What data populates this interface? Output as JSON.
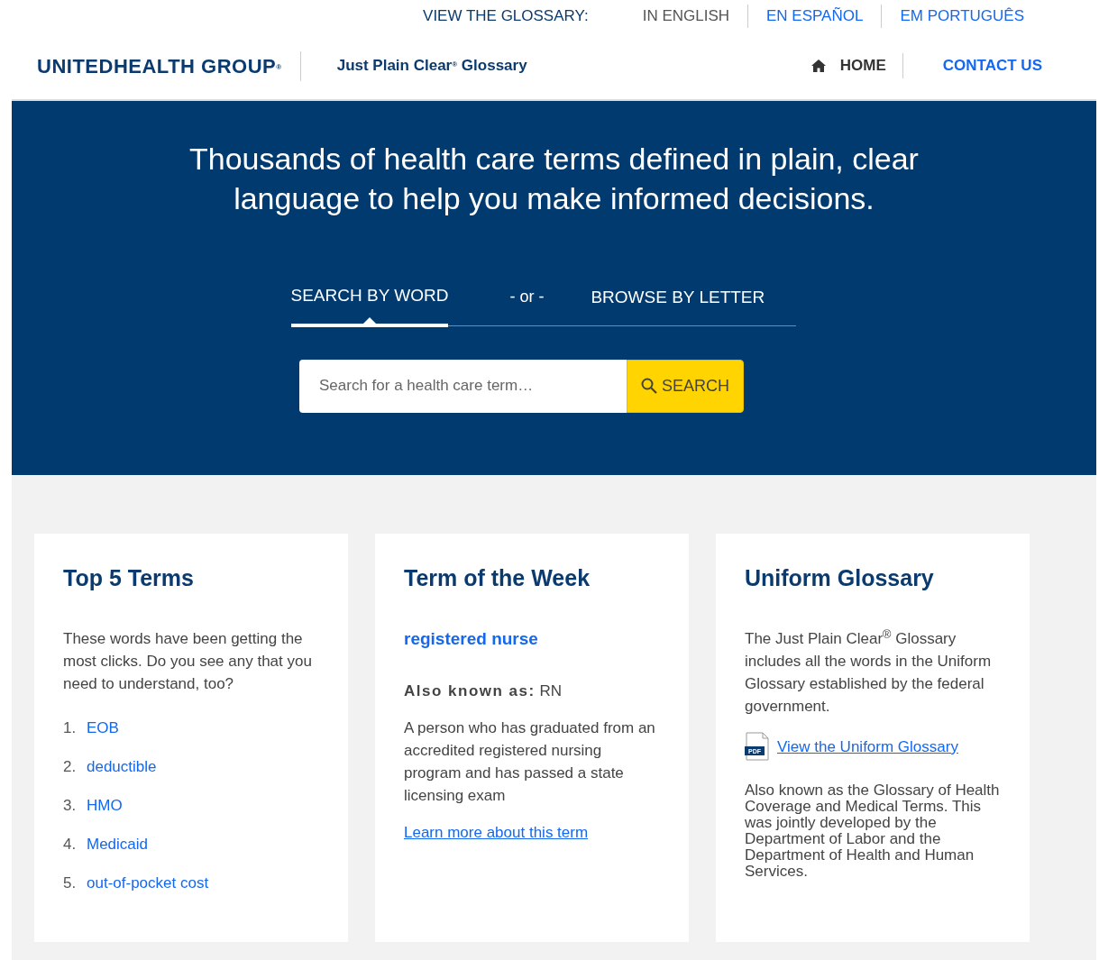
{
  "language_bar": {
    "label": "VIEW THE GLOSSARY:",
    "languages": [
      {
        "label": "IN ENGLISH",
        "selected": true
      },
      {
        "label": "EN ESPAÑOL",
        "selected": false
      },
      {
        "label": "EM PORTUGUÊS",
        "selected": false
      }
    ]
  },
  "header": {
    "logo": "UNITEDHEALTH GROUP$^{®}$",
    "site_title": "Just Plain Clear$^{®}$ Glossary",
    "nav": [
      {
        "label": "HOME",
        "kind": "home"
      },
      {
        "label": "CONTACT US",
        "kind": "link"
      }
    ]
  },
  "hero": {
    "heading": "Thousands of health care terms defined in plain, clear language to help you make informed decisions.",
    "tabs": [
      {
        "label": "SEARCH BY WORD",
        "selected": true
      },
      {
        "label": "BROWSE BY LETTER",
        "selected": false
      }
    ],
    "separator": "- or -",
    "search": {
      "placeholder": "Search for a health care term…",
      "button": "SEARCH"
    }
  },
  "cards": [
    {
      "kind": "top_terms",
      "title": "Top 5 Terms",
      "intro": "These words have been getting the most clicks. Do you see any that you need to understand, too?",
      "terms": [
        {
          "number": "1.",
          "label": "EOB"
        },
        {
          "number": "2.",
          "label": "deductible"
        },
        {
          "number": "3.",
          "label": "HMO"
        },
        {
          "number": "4.",
          "label": "Medicaid"
        },
        {
          "number": "5.",
          "label": "out-of-pocket cost"
        }
      ]
    },
    {
      "kind": "term_of_week",
      "title": "Term of the Week",
      "term": "registered nurse",
      "aka_label": "Also known as:",
      "aka_value": "RN",
      "definition": "A person who has graduated from an accredited registered nursing program and has passed a state licensing exam",
      "link": "Learn more about this term"
    },
    {
      "kind": "uniform",
      "title": "Uniform Glossary",
      "intro": "The Just Plain Clear$^{®}$ Glossary includes all the words in the Uniform Glossary established by the federal government.",
      "pdf_label": "PDF",
      "link": "View the Uniform Glossary",
      "note": "Also known as the Glossary of Health Coverage and Medical Terms. This was jointly developed by the Department of Labor and the Department of Health and Human Services."
    }
  ]
}
